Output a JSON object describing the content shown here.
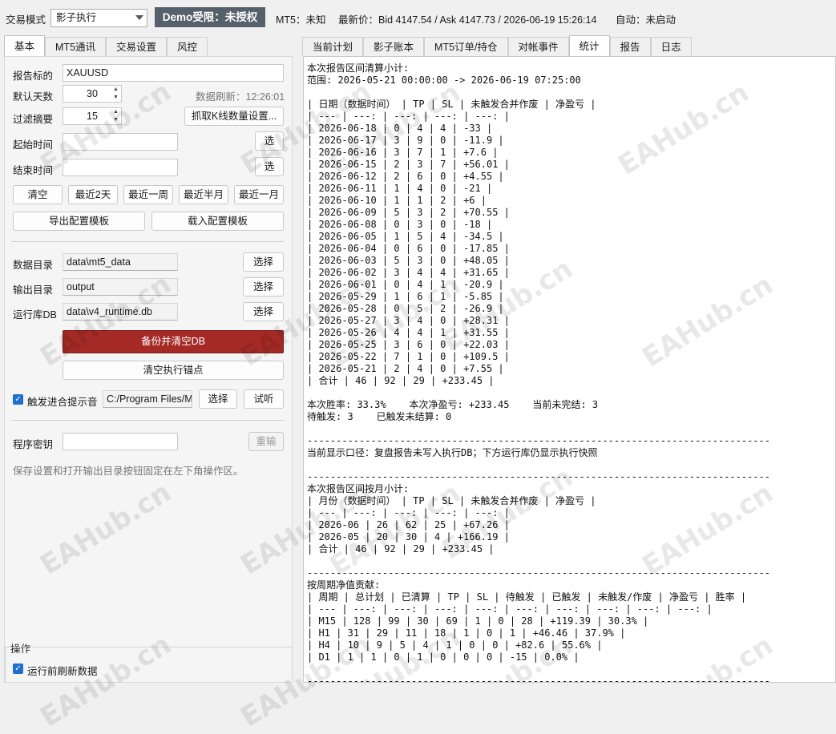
{
  "topbar": {
    "mode_label": "交易模式",
    "mode_value": "影子执行",
    "demo_badge": "Demo受限：未授权",
    "mt5_status": "MT5：未知",
    "latest_price": "最新价：Bid 4147.54 / Ask 4147.73 / 2026-06-19 15:26:14",
    "auto_status": "自动：未启动"
  },
  "left_tabs": [
    "基本",
    "MT5通讯",
    "交易设置",
    "风控"
  ],
  "right_tabs": [
    "当前计划",
    "影子账本",
    "MT5订单/持仓",
    "对帐事件",
    "统计",
    "报告",
    "日志"
  ],
  "basic": {
    "symbol_label": "报告标的",
    "symbol_value": "XAUUSD",
    "days_label": "默认天数",
    "days_value": "30",
    "refresh_text": "数据刷新：12:26:01",
    "filter_label": "过滤摘要",
    "filter_value": "15",
    "fetch_kline_button": "抓取K线数量设置...",
    "start_label": "起始时间",
    "end_label": "结束时间",
    "pick_button": "选",
    "quick_buttons": [
      "清空",
      "最近2天",
      "最近一周",
      "最近半月",
      "最近一月"
    ],
    "export_template_button": "导出配置模板",
    "import_template_button": "载入配置模板",
    "data_dir_label": "数据目录",
    "data_dir_value": "data\\mt5_data",
    "output_dir_label": "输出目录",
    "output_dir_value": "output",
    "runtime_db_label": "运行库DB",
    "runtime_db_value": "data\\v4_runtime.db",
    "select_button": "选择",
    "backup_clear_button": "备份并清空DB",
    "clear_anchor_button": "清空执行锚点",
    "trigger_sound_label": "触发进合提示音",
    "trigger_sound_path": "C:/Program Files/M",
    "listen_button": "试听",
    "program_key_label": "程序密钥",
    "reenter_button": "重输",
    "hint_text": "保存设置和打开输出目录按钮固定在左下角操作区。"
  },
  "operations": {
    "title": "操作",
    "refresh_before_run": "运行前刷新数据"
  },
  "report": {
    "lines": [
      "本次报告区间清算小计:",
      "范围: 2026-05-21 00:00:00 -> 2026-06-19 07:25:00",
      "",
      "| 日期（数据时间） | TP | SL | 未触发合并作废 | 净盈亏 |",
      "| --- | ---: | ---: | ---: | ---: |",
      "| 2026-06-18 | 0 | 4 | 4 | -33 |",
      "| 2026-06-17 | 3 | 9 | 0 | -11.9 |",
      "| 2026-06-16 | 3 | 7 | 1 | +7.6 |",
      "| 2026-06-15 | 2 | 3 | 7 | +56.01 |",
      "| 2026-06-12 | 2 | 6 | 0 | +4.55 |",
      "| 2026-06-11 | 1 | 4 | 0 | -21 |",
      "| 2026-06-10 | 1 | 1 | 2 | +6 |",
      "| 2026-06-09 | 5 | 3 | 2 | +70.55 |",
      "| 2026-06-08 | 0 | 3 | 0 | -18 |",
      "| 2026-06-05 | 1 | 5 | 4 | -34.5 |",
      "| 2026-06-04 | 0 | 6 | 0 | -17.85 |",
      "| 2026-06-03 | 5 | 3 | 0 | +48.05 |",
      "| 2026-06-02 | 3 | 4 | 4 | +31.65 |",
      "| 2026-06-01 | 0 | 4 | 1 | -20.9 |",
      "| 2026-05-29 | 1 | 6 | 1 | -5.85 |",
      "| 2026-05-28 | 0 | 5 | 2 | -26.9 |",
      "| 2026-05-27 | 3 | 4 | 0 | +28.31 |",
      "| 2026-05-26 | 4 | 4 | 1 | +31.55 |",
      "| 2026-05-25 | 3 | 6 | 0 | +22.03 |",
      "| 2026-05-22 | 7 | 1 | 0 | +109.5 |",
      "| 2026-05-21 | 2 | 4 | 0 | +7.55 |",
      "| 合计 | 46 | 92 | 29 | +233.45 |",
      "",
      "本次胜率: 33.3%    本次净盈亏: +233.45    当前未完结: 3",
      "待触发: 3    已触发未结算: 0",
      "",
      "--------------------------------------------------------------------------------",
      "当前显示口径：复盘报告未写入执行DB；下方运行库仍显示执行快照",
      "",
      "--------------------------------------------------------------------------------",
      "本次报告区间按月小计:",
      "| 月份（数据时间） | TP | SL | 未触发合并作废 | 净盈亏 |",
      "| --- | ---: | ---: | ---: | ---: |",
      "| 2026-06 | 26 | 62 | 25 | +67.26 |",
      "| 2026-05 | 20 | 30 | 4 | +166.19 |",
      "| 合计 | 46 | 92 | 29 | +233.45 |",
      "",
      "--------------------------------------------------------------------------------",
      "按周期净值贡献:",
      "| 周期 | 总计划 | 已清算 | TP | SL | 待触发 | 已触发 | 未触发/作废 | 净盈亏 | 胜率 |",
      "| --- | ---: | ---: | ---: | ---: | ---: | ---: | ---: | ---: | ---: |",
      "| M15 | 128 | 99 | 30 | 69 | 1 | 0 | 28 | +119.39 | 30.3% |",
      "| H1 | 31 | 29 | 11 | 18 | 1 | 0 | 1 | +46.46 | 37.9% |",
      "| H4 | 10 | 9 | 5 | 4 | 1 | 0 | 0 | +82.6 | 55.6% |",
      "| D1 | 1 | 1 | 0 | 1 | 0 | 0 | 0 | -15 | 0.0% |",
      "",
      "--------------------------------------------------------------------------------"
    ]
  },
  "watermark": "EAHub.cn",
  "colors": {
    "accent_red": "#a52a26",
    "badge_bg": "#56606a",
    "check_blue": "#1f6fd0"
  }
}
